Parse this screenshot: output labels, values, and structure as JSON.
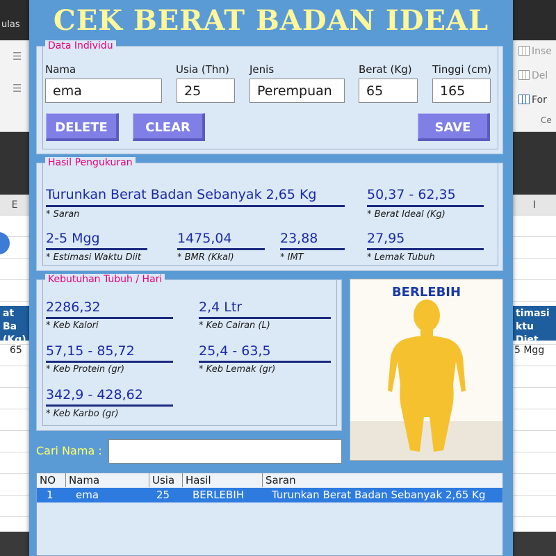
{
  "background": {
    "ribbon_tab_label": "ulas",
    "ribbon_right_items": [
      "Inse",
      "Del",
      "For"
    ],
    "ribbon_group_label": "Ce",
    "column_left": "E",
    "column_right": "I",
    "left_header_1": "at Ba",
    "left_header_2": "(Kg)",
    "left_value": "65",
    "right_header_1": "timasi",
    "right_header_2": "ktu Diet",
    "right_value": "5 Mgg"
  },
  "app": {
    "title": "CEK BERAT BADAN IDEAL"
  },
  "data_individu": {
    "legend": "Data Individu",
    "labels": {
      "nama": "Nama",
      "usia": "Usia (Thn)",
      "jenis": "Jenis",
      "berat": "Berat (Kg)",
      "tinggi": "Tinggi (cm)"
    },
    "values": {
      "nama": "ema",
      "usia": "25",
      "jenis": "Perempuan",
      "berat": "65",
      "tinggi": "165"
    },
    "buttons": {
      "delete": "DELETE",
      "clear": "CLEAR",
      "save": "SAVE"
    }
  },
  "hasil": {
    "legend": "Hasil Pengukuran",
    "saran": {
      "value": "Turunkan Berat Badan Sebanyak 2,65 Kg",
      "caption": "* Saran"
    },
    "berat_ideal": {
      "value": "50,37 - 62,35",
      "caption": "* Berat Ideal (Kg)"
    },
    "waktu_diit": {
      "value": "2-5 Mgg",
      "caption": "* Estimasi Waktu Diit"
    },
    "bmr": {
      "value": "1475,04",
      "caption": "* BMR (Kkal)"
    },
    "imt": {
      "value": "23,88",
      "caption": "* IMT"
    },
    "lemak": {
      "value": "27,95",
      "caption": "* Lemak Tubuh"
    }
  },
  "kebutuhan": {
    "legend": "Kebutuhan Tubuh / Hari",
    "kalori": {
      "value": "2286,32",
      "caption": "* Keb Kalori"
    },
    "cairan": {
      "value": "2,4 Ltr",
      "caption": "* Keb Cairan (L)"
    },
    "protein": {
      "value": "57,15 - 85,72",
      "caption": "* Keb Protein (gr)"
    },
    "lemak": {
      "value": "25,4 - 63,5",
      "caption": "* Keb Lemak (gr)"
    },
    "karbo": {
      "value": "342,9 - 428,62",
      "caption": "* Keb Karbo (gr)"
    }
  },
  "status": {
    "label": "BERLEBIH",
    "figure_color": "#f5c12e"
  },
  "search": {
    "label": "Cari Nama :",
    "value": ""
  },
  "table": {
    "headers": [
      "NO",
      "Nama",
      "Usia",
      "Hasil",
      "Saran"
    ],
    "rows": [
      [
        "1",
        "ema",
        "25",
        "BERLEBIH",
        "Turunkan Berat Badan Sebanyak 2,65 Kg"
      ]
    ]
  },
  "colors": {
    "window": "#5b9bd5",
    "panel": "#dbe8f5",
    "title": "#fff799",
    "legend": "#e8007a",
    "button": "#7f7fe6",
    "value": "#1a2aa8",
    "selected_row": "#2e7be0"
  }
}
